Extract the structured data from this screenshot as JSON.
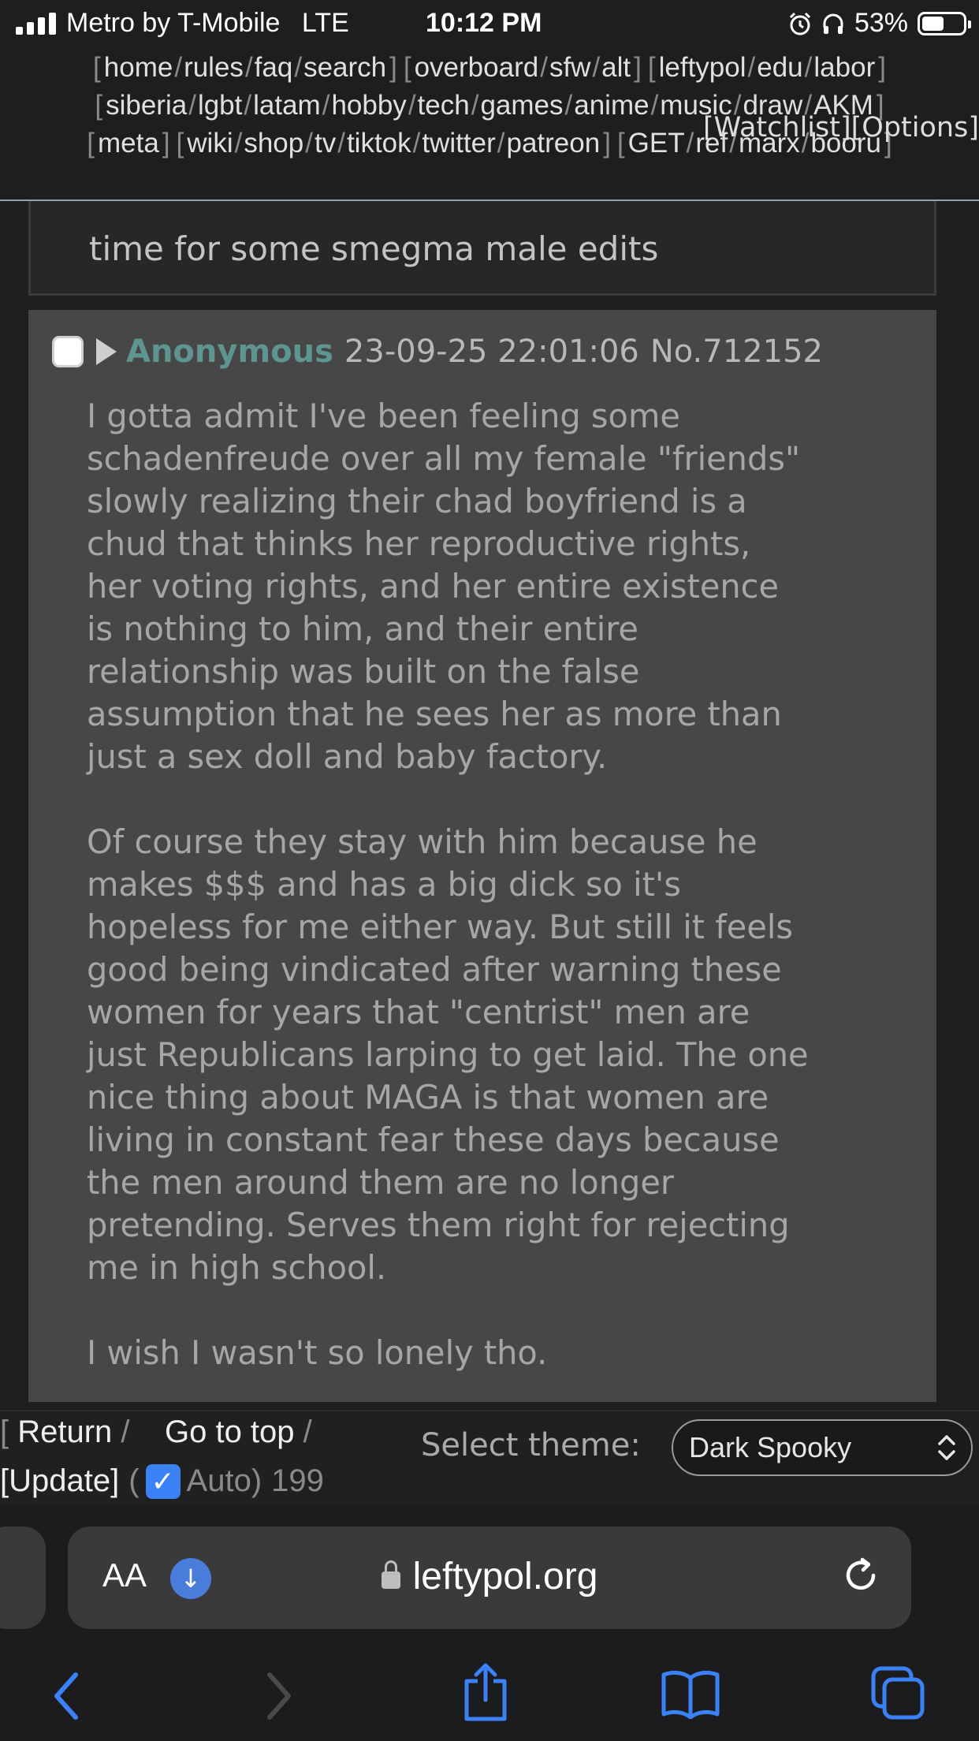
{
  "status_bar": {
    "carrier": "Metro by T-Mobile",
    "network": "LTE",
    "time": "10:12 PM",
    "battery": "53%",
    "battery_level": 0.53
  },
  "board_nav": {
    "lines": [
      [
        [
          "home",
          "rules",
          "faq",
          "search"
        ],
        [
          "overboard",
          "sfw",
          "alt"
        ],
        [
          "leftypol",
          "edu",
          "labor"
        ]
      ],
      [
        [
          "siberia",
          "lgbt",
          "latam",
          "hobby",
          "tech",
          "games",
          "anime",
          "music",
          "draw",
          "AKM"
        ]
      ],
      [
        [
          "meta"
        ],
        [
          "wiki",
          "shop",
          "tv",
          "tiktok",
          "twitter",
          "patreon"
        ],
        [
          "GET",
          "ref",
          "marx",
          "booru"
        ]
      ]
    ],
    "watchlist": "[Watchlist]",
    "options": "[Options]"
  },
  "op_post": {
    "body": "time for some smegma male edits"
  },
  "reply": {
    "name": "Anonymous",
    "date": "23-09-25 22:01:06",
    "number": "No.712152",
    "paragraphs": [
      "I gotta admit I've been feeling some\nschadenfreude over all my female \"friends\"\nslowly realizing their chad boyfriend is a\nchud that thinks her reproductive rights,\nher voting rights, and her entire existence\nis nothing to him, and their entire\nrelationship was built on the false\nassumption that he sees her as more than\njust a sex doll and baby factory.",
      "Of course they stay with him because he\nmakes $$$ and has a big dick so it's\nhopeless for me either way. But still it feels\ngood being vindicated after warning these\nwomen for years that \"centrist\" men are\njust Republicans larping to get laid. The one\nnice thing about MAGA is that women are\nliving in constant fear these days because\nthe men around them are no longer\npretending. Serves them right for rejecting\nme in high school.",
      "I wish I wasn't so lonely tho."
    ]
  },
  "thread_bar": {
    "return": "Return",
    "go_to_top": "Go to top",
    "update": "[Update]",
    "auto": "Auto)",
    "count": "199",
    "theme_label": "Select theme:",
    "theme_value": "Dark Spooky"
  },
  "safari": {
    "text_size": "AA",
    "url": "leftypol.org"
  },
  "icons": [
    "alarm-icon",
    "headphones-icon",
    "checkmark-icon",
    "download-icon",
    "lock-icon",
    "reload-icon",
    "back-icon",
    "forward-icon",
    "share-icon",
    "bookmarks-icon",
    "tabs-icon"
  ],
  "colors": {
    "background": "#1e1e1e",
    "reply_bg": "#474747",
    "name": "#5f9590",
    "accent_blue": "#3a82f6"
  }
}
